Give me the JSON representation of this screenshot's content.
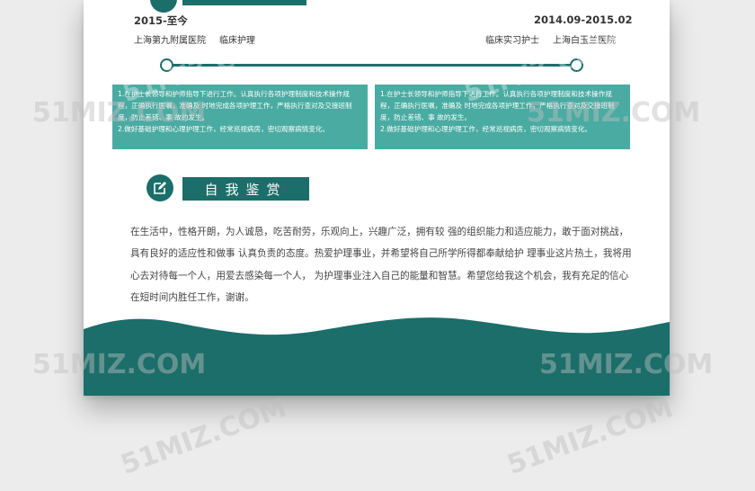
{
  "experience": {
    "left": {
      "date": "2015-至今",
      "hospital": "上海第九附属医院",
      "role": "临床护理",
      "duties": [
        "1.在护士长领导和护师指导下进行工作。认真执行各项护理制度和技术操作规程，正确执行医嘱，准确及 时地完成各项护理工作，严格执行查对及交接班制度，防止差错、事 故的发生。",
        "2.做好基础护理和心理护理工作，经常巡视病房，密切观察病情变化。"
      ]
    },
    "right": {
      "date": "2014.09-2015.02",
      "role": "临床实习护士",
      "hospital": "上海白玉兰医院",
      "duties": [
        "1.在护士长领导和护师指导下进行工作。认真执行各项护理制度和技术操作规程，正确执行医嘱，准确及 时地完成各项护理工作，严格执行查对及交接班制度，防止差错、事 故的发生。",
        "2.做好基础护理和心理护理工作，经常巡视病房，密切观察病情变化。"
      ]
    }
  },
  "self_evaluation": {
    "title": "自我鉴赏",
    "icon": "edit-icon",
    "text": "在生活中，性格开朗，为人诚恳，吃苦耐劳，乐观向上，兴趣广泛，拥有较 强的组织能力和适应能力，敢于面对挑战，具有良好的适应性和做事 认真负责的态度。热爱护理事业，并希望将自己所学所得都奉献给护 理事业这片热土，我将用心去对待每一个人，用爱去感染每一个人， 为护理事业注入自己的能量和智慧。希望您给我这个机会，我有充足的信心在短时间内胜任工作，谢谢。"
  },
  "watermark": "51MIZ.COM",
  "colors": {
    "accent_dark": "#1b6e6a",
    "accent_light": "#4aaba2"
  }
}
